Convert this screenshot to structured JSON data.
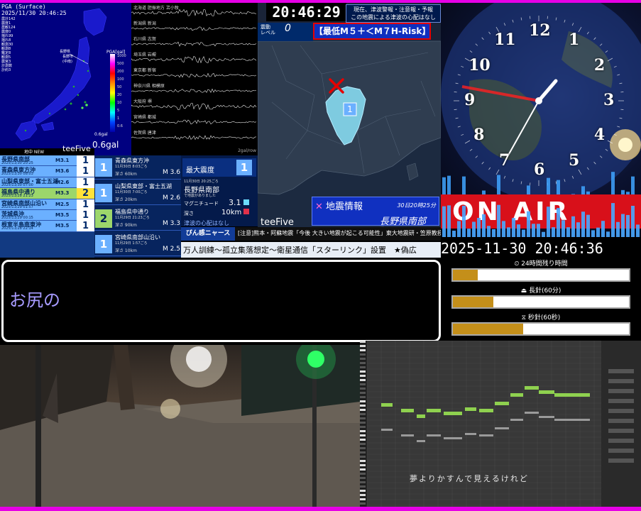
{
  "pga": {
    "header": "PGA (Surface)",
    "time": "2025/11/30 20:46:25",
    "stats": [
      "農計142",
      "震度1",
      "農観124",
      "震度0",
      "揺れ99",
      "揺れ8",
      "観測30",
      "観測8",
      "鑑定8",
      "観測5",
      "震宮3",
      "計測数",
      "計約3"
    ],
    "scale_label": "PGA[gal]",
    "scale_ticks": [
      "1000",
      "500",
      "200",
      "100",
      "50",
      "20",
      "10",
      "5",
      "1",
      "0.6"
    ],
    "small_value": "0.6gal",
    "value": "0.6gal",
    "map_labels": [
      "長野県",
      "長野市",
      "(中南)"
    ],
    "colors": {
      "bg": "#000080",
      "land": "#1a1acc"
    }
  },
  "waveforms": {
    "stations": [
      "北海道 胆振地方 苫小牧",
      "新潟県 新潟",
      "石川県 志賀",
      "埼玉県 岩槻",
      "東京都 新宿",
      "神奈川県 相模原",
      "大阪府 堺",
      "宮崎県 都城",
      "佐賀県 唐津"
    ],
    "unit": "2gal/row"
  },
  "map": {
    "time": "20:46:29",
    "tsunami_line1": "現在、津波警報・注意報・予報",
    "tsunami_line2": "この地震による津波の心配はなし",
    "shindo_label_1": "震動",
    "shindo_label_2": "レベル",
    "shindo_value": "0",
    "risk": "【最低M５＋＜M７H-Risk】",
    "epicenter_intensity": "1",
    "brand": "teeFive",
    "info_title": "地震情報",
    "info_time": "30日20時25分",
    "info_location": "長野県南部",
    "colors": {
      "sea": "#1a2438",
      "land": "#2c3a4a",
      "region": "#7ecbe0",
      "mark": "#e60000"
    }
  },
  "list_header": "地中 NEW",
  "list_brand": "teeFive",
  "quake_list": [
    {
      "name": "長野県南部",
      "date": "2025/11/30 20:25",
      "mag": "M3.1",
      "shindo": "1",
      "hl": false
    },
    {
      "name": "青森県東方沖",
      "date": "2025/11/30 08:03",
      "mag": "M3.6",
      "shindo": "1",
      "hl": false
    },
    {
      "name": "山梨県東部・富士五湖",
      "date": "2025/11/30 07:00",
      "mag": "M2.6",
      "shindo": "1",
      "hl": false
    },
    {
      "name": "福島県中通り",
      "date": "2025/11/28 21:23",
      "mag": "M3.3",
      "shindo": "2",
      "hl": true
    },
    {
      "name": "宮崎県南部山沿い",
      "date": "2025/11/29 01:57",
      "mag": "M2.5",
      "shindo": "1",
      "hl": false
    },
    {
      "name": "茨城県沖",
      "date": "2025/11/29 00:15",
      "mag": "M3.5",
      "shindo": "1",
      "hl": false
    },
    {
      "name": "根室半島南東沖",
      "date": "2025/11/28 22:14",
      "mag": "M3.5",
      "shindo": "1",
      "hl": false
    }
  ],
  "quake_detail": [
    {
      "name": "青森県東方沖",
      "date": "11月30日 8:03ごろ",
      "depth": "深さ 60km",
      "mag": "M 3.6",
      "shindo": "1",
      "green": false
    },
    {
      "name": "山梨県東部・富士五湖",
      "date": "11月30日 7:00ごろ",
      "depth": "深さ 20km",
      "mag": "M 2.6",
      "shindo": "1",
      "green": false
    },
    {
      "name": "福島県中通り",
      "date": "11月29日 21:23ごろ",
      "depth": "深さ 90km",
      "mag": "M 3.3",
      "shindo": "2",
      "green": true
    },
    {
      "name": "宮崎県南部山沿い",
      "date": "11月29日 1:57ごろ",
      "depth": "深さ 10km",
      "mag": "M 2.5",
      "shindo": "1",
      "green": false
    }
  ],
  "max_shindo": {
    "label": "最大震度",
    "value": "1",
    "time": "11月30日 20:25ごろ",
    "location": "長野県南部",
    "sub": "で地震がありました",
    "mag_label": "マグニチュード",
    "mag_value": "3.1",
    "depth_label": "深さ",
    "depth_value": "10km",
    "tsunami": "津波の心配はなし"
  },
  "news": {
    "label": "ぴん感ニャース",
    "ticker": "[注意]熊本・阿蘇地震「今後 大きい地震が起こる可能性」東大地震研・笠原教授",
    "headline": "万人訓練～孤立集落想定～衛星通信「スターリンク」設置　★偽広"
  },
  "clock": {
    "numbers": [
      "12",
      "1",
      "2",
      "3",
      "4",
      "5",
      "6",
      "7",
      "8",
      "9",
      "10",
      "11"
    ],
    "onair": "ON AIR",
    "datetime": "2025-11-30 20:46:36",
    "time_hours": 20,
    "time_minutes": 46,
    "time_seconds": 36
  },
  "remaining": {
    "title": "24時間残り時間",
    "minute_label": "長針(60分)",
    "second_label": "秒針(60秒)",
    "day_fraction": 0.14,
    "minute_fraction": 0.23,
    "second_fraction": 0.4
  },
  "caption": {
    "text": "お尻の"
  },
  "daw": {
    "lyric": "夢よりかすんで見えるけれど"
  }
}
